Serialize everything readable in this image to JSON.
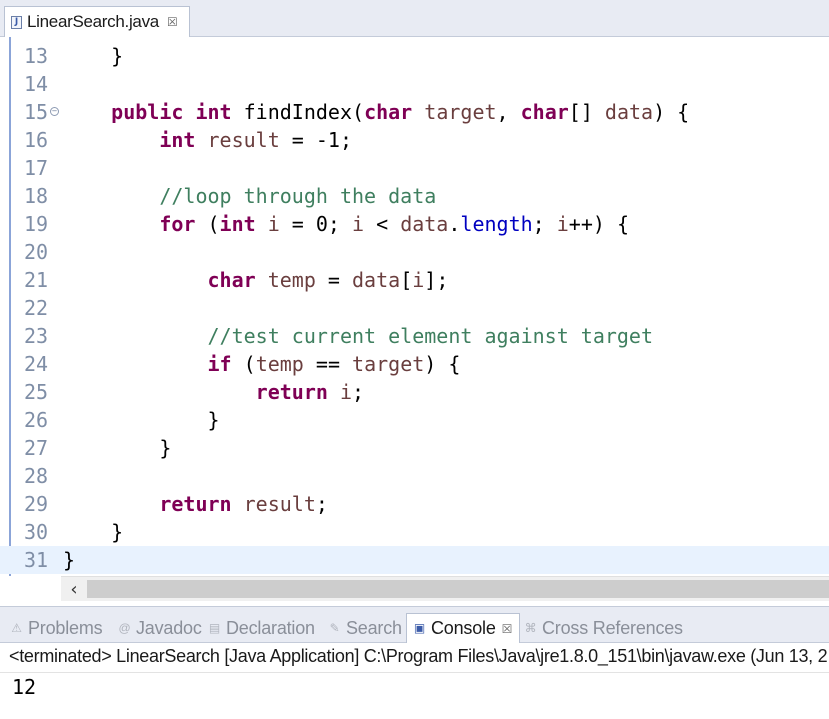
{
  "editor_tab": {
    "label": "LinearSearch.java",
    "icon": "java-file-icon",
    "close": "☒"
  },
  "code_lines": [
    {
      "num": "13",
      "code": "    }"
    },
    {
      "num": "14",
      "code": ""
    },
    {
      "num": "15",
      "code": "    public int findIndex(char target, char[] data) {",
      "fold": true
    },
    {
      "num": "16",
      "code": "        int result = -1;"
    },
    {
      "num": "17",
      "code": ""
    },
    {
      "num": "18",
      "code": "        //loop through the data"
    },
    {
      "num": "19",
      "code": "        for (int i = 0; i < data.length; i++) {"
    },
    {
      "num": "20",
      "code": ""
    },
    {
      "num": "21",
      "code": "            char temp = data[i];"
    },
    {
      "num": "22",
      "code": ""
    },
    {
      "num": "23",
      "code": "            //test current element against target"
    },
    {
      "num": "24",
      "code": "            if (temp == target) {"
    },
    {
      "num": "25",
      "code": "                return i;"
    },
    {
      "num": "26",
      "code": "            }"
    },
    {
      "num": "27",
      "code": "        }"
    },
    {
      "num": "28",
      "code": ""
    },
    {
      "num": "29",
      "code": "        return result;"
    },
    {
      "num": "30",
      "code": "    }"
    },
    {
      "num": "31",
      "code": "}",
      "current": true
    }
  ],
  "colors": {
    "keyword": "#7f0055",
    "comment": "#3f7f5f",
    "local_variable": "#6a3e3e",
    "field": "#0000c0",
    "current_line": "#e8f2fe"
  },
  "scrollbar": {
    "left_arrow": "‹"
  },
  "views_tabs": [
    {
      "label": "Problems",
      "icon": "problems-icon",
      "glyph": "⚠",
      "active": false
    },
    {
      "label": "Javadoc",
      "icon": "javadoc-icon",
      "glyph": "@",
      "active": false
    },
    {
      "label": "Declaration",
      "icon": "declaration-icon",
      "glyph": "▤",
      "active": false
    },
    {
      "label": "Search",
      "icon": "search-icon",
      "glyph": "✎",
      "active": false
    },
    {
      "label": "Console",
      "icon": "console-icon",
      "glyph": "▣",
      "active": true,
      "close": "☒"
    },
    {
      "label": "Cross References",
      "icon": "cross-references-icon",
      "glyph": "⌘",
      "active": false
    }
  ],
  "console": {
    "status": "<terminated> LinearSearch [Java Application] C:\\Program Files\\Java\\jre1.8.0_151\\bin\\javaw.exe (Jun 13, 2",
    "output": "12"
  }
}
